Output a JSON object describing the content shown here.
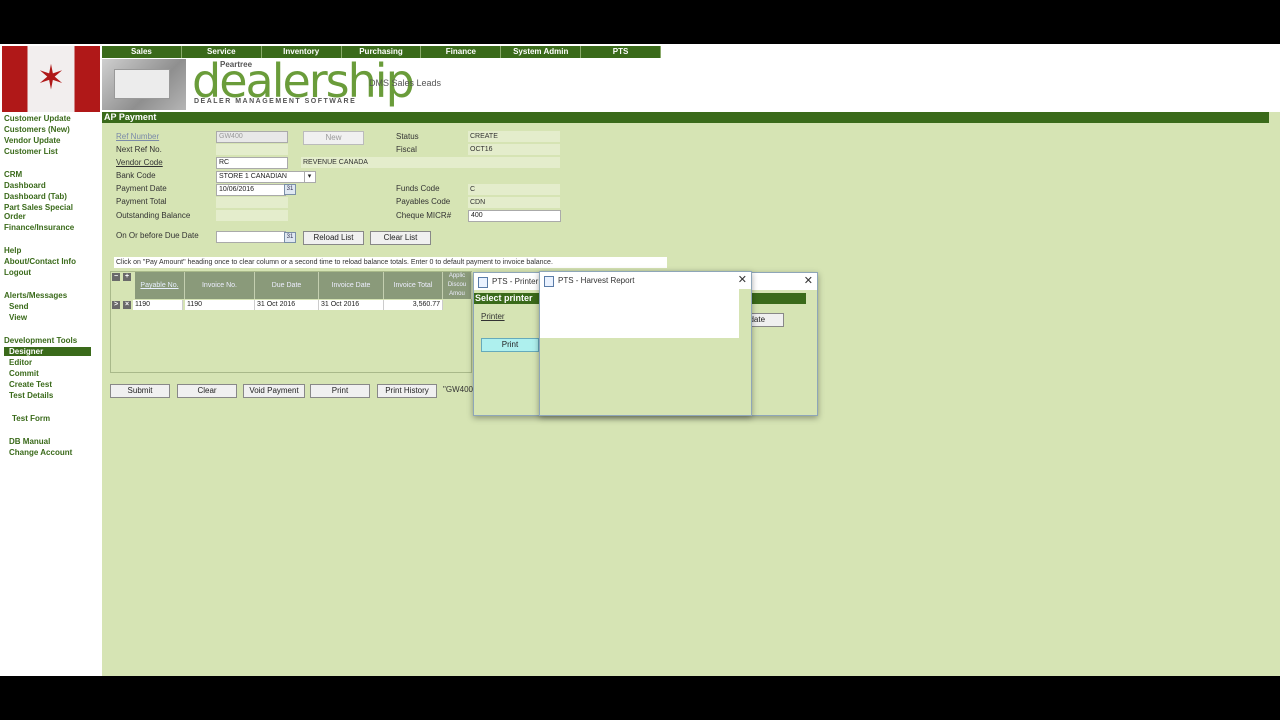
{
  "nav": {
    "links": [
      "Customer Update",
      "Customers (New)",
      "Vendor Update",
      "Customer List",
      "CRM",
      "Dashboard",
      "Dashboard (Tab)",
      "Part Sales Special",
      "Order",
      "Finance/Insurance",
      "Help",
      "About/Contact Info",
      "Logout",
      "Alerts/Messages",
      "Send",
      "View",
      "Development Tools",
      "Designer",
      "Editor",
      "Commit",
      "Create Test",
      "Test Details",
      "Test Form",
      "DB Manual",
      "Change Account"
    ]
  },
  "topmenu": [
    "Sales",
    "Service",
    "Inventory",
    "Purchasing",
    "Finance",
    "System Admin",
    "PTS"
  ],
  "brand": {
    "pre": "Peartree",
    "name": "dealership",
    "tagline": "DEALER MANAGEMENT SOFTWARE",
    "module": "DMS Sales Leads"
  },
  "page": {
    "title": "AP Payment"
  },
  "form": {
    "ref_number_label": "Ref Number",
    "ref_number_value": "GW400",
    "new_button": "New",
    "next_ref_label": "Next Ref No.",
    "vendor_code_label": "Vendor Code",
    "vendor_code_value": "RC",
    "vendor_name": "REVENUE CANADA",
    "bank_code_label": "Bank Code",
    "bank_code_value": "STORE 1 CANADIAN",
    "payment_date_label": "Payment Date",
    "payment_date_value": "10/06/2016",
    "payment_total_label": "Payment Total",
    "outstanding_label": "Outstanding Balance",
    "status_label": "Status",
    "status_value": "CREATE",
    "fiscal_label": "Fiscal",
    "fiscal_value": "OCT16",
    "funds_code_label": "Funds Code",
    "funds_code_value": "C",
    "payables_code_label": "Payables Code",
    "payables_code_value": "CDN",
    "cheque_label": "Cheque MICR#",
    "cheque_value": "400",
    "due_date_label": "On Or before Due Date",
    "reload_button": "Reload List",
    "clear_list_button": "Clear List",
    "hint": "Click on \"Pay Amount\" heading once to clear column or a second time to reload balance totals. Enter 0 to default payment to invoice balance."
  },
  "grid": {
    "headers": [
      "Payable No.",
      "Invoice No.",
      "Due Date",
      "Invoice Date",
      "Invoice Total",
      "Applic Discou Amou"
    ],
    "rows": [
      [
        "1190",
        "1190",
        "31 Oct 2016",
        "31 Oct 2016",
        "3,560.77",
        ""
      ]
    ]
  },
  "actions": {
    "submit": "Submit",
    "clear": "Clear",
    "void": "Void Payment",
    "print": "Print",
    "history": "Print History",
    "ref_tag": "\"GW400"
  },
  "printer_dialog": {
    "title": "PTS - Printer",
    "header": "Select printer",
    "printer_label": "Printer",
    "print_button": "Print",
    "update_button": "pdate"
  },
  "harvest_dialog": {
    "title": "PTS - Harvest Report"
  }
}
